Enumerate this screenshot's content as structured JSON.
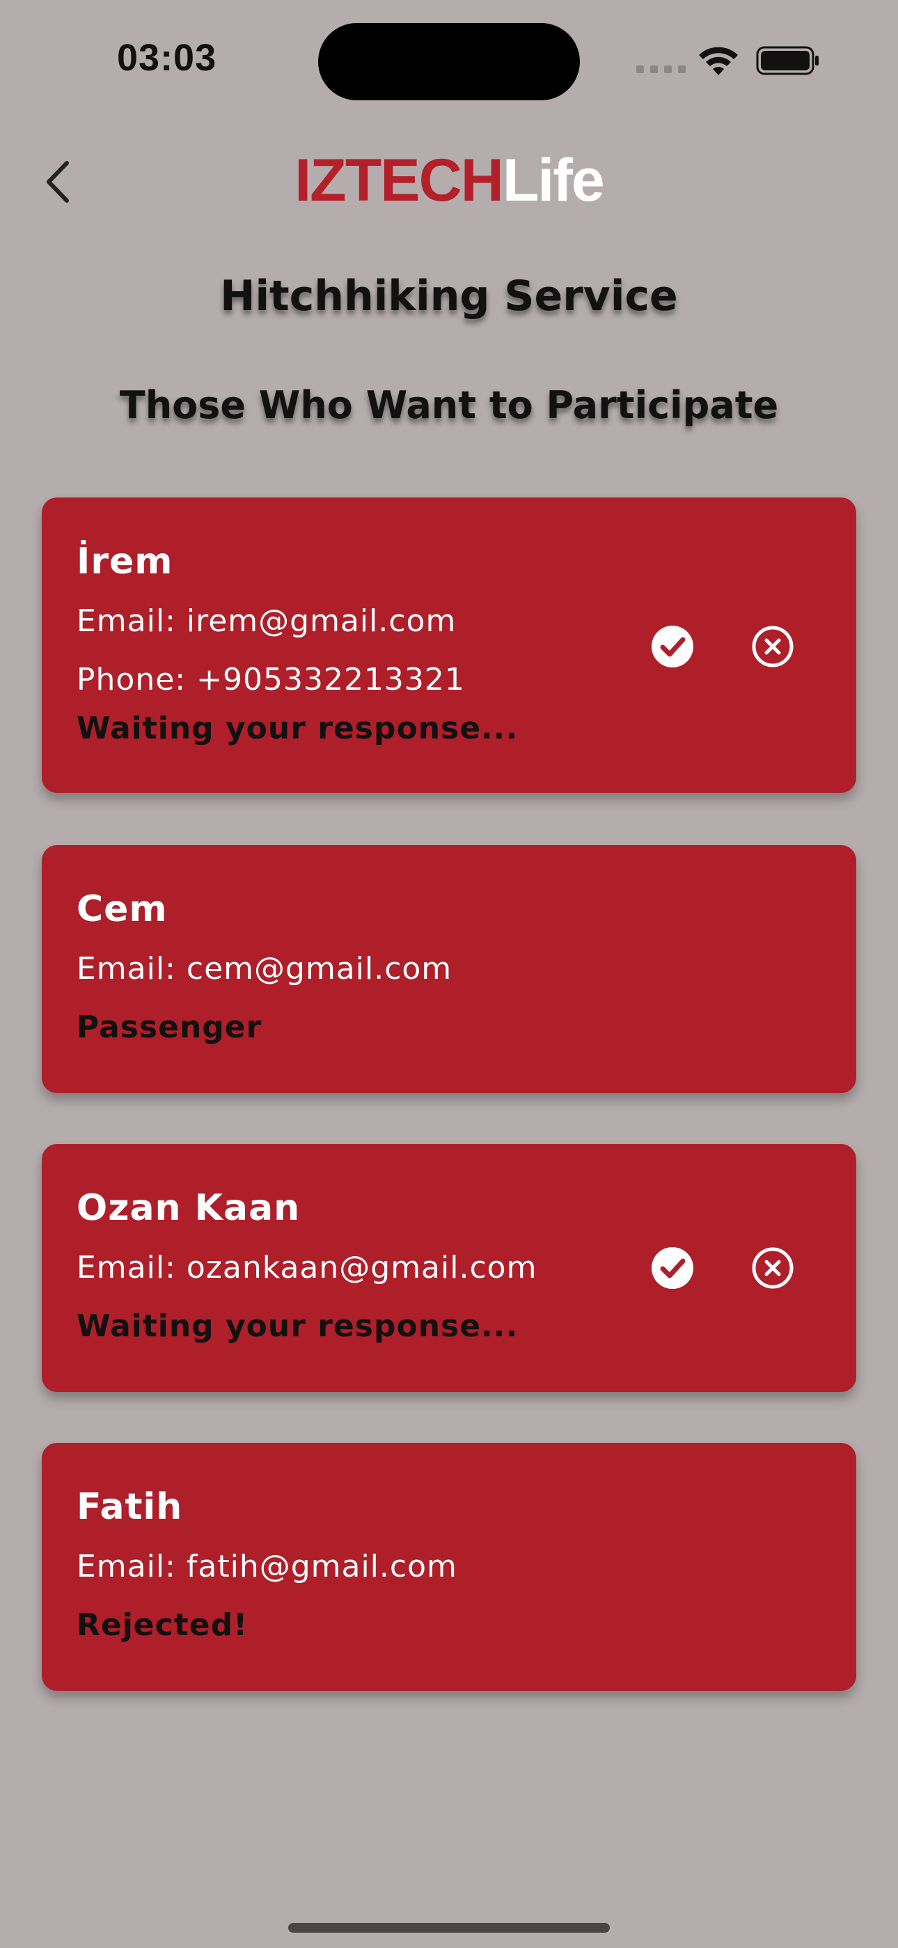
{
  "status_bar": {
    "time": "03:03"
  },
  "header": {
    "logo_red": "IZTECH",
    "logo_white": "Life",
    "back_icon": "chevron-left-icon"
  },
  "page": {
    "title": "Hitchhiking Service",
    "section_title": "Those Who Want to Participate"
  },
  "colors": {
    "background": "#b5adad",
    "card": "#ae1f2a",
    "brand_red": "#b3202a"
  },
  "participants": [
    {
      "name": "İrem",
      "email": "Email: irem@gmail.com",
      "phone": "Phone: +905332213321",
      "status": "Waiting your response...",
      "actions": [
        "check-circle-icon",
        "x-circle-icon"
      ]
    },
    {
      "name": "Cem",
      "email": "Email: cem@gmail.com",
      "status": "Passenger"
    },
    {
      "name": "Ozan Kaan",
      "email": "Email: ozankaan@gmail.com",
      "status": "Waiting your response...",
      "actions": [
        "check-circle-icon",
        "x-circle-icon"
      ]
    },
    {
      "name": "Fatih",
      "email": "Email: fatih@gmail.com",
      "status": "Rejected!"
    }
  ]
}
